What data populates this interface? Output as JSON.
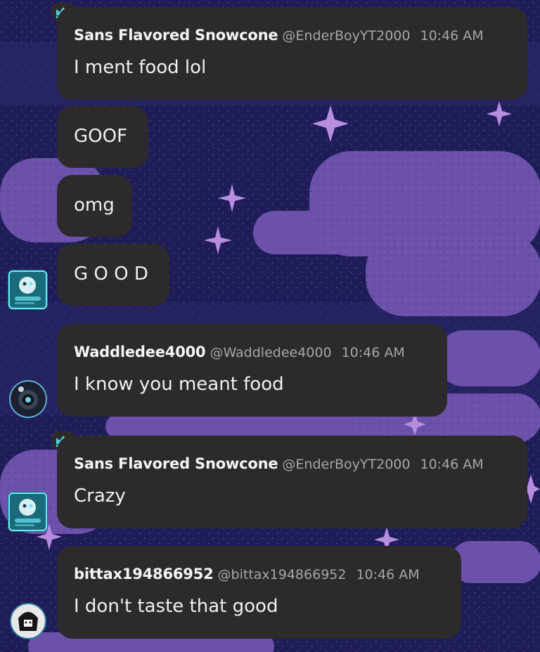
{
  "messages": [
    {
      "name": "Sans Flavored Snowcone",
      "handle": "@EnderBoyYT2000",
      "time": "10:46 AM",
      "text": "I ment food lol"
    },
    {
      "text": "GOOF"
    },
    {
      "text": "omg"
    },
    {
      "text": "G O O D"
    },
    {
      "name": "Waddledee4000",
      "handle": "@Waddledee4000",
      "time": "10:46 AM",
      "text": "I know you meant food"
    },
    {
      "name": "Sans Flavored Snowcone",
      "handle": "@EnderBoyYT2000",
      "time": "10:46 AM",
      "text": "Crazy"
    },
    {
      "name": "bittax194866952",
      "handle": "@bittax194866952",
      "time": "10:46 AM",
      "text": "I don't taste that good"
    }
  ],
  "icons": {
    "crown": "crown-icon"
  },
  "colors": {
    "background": "#24215c",
    "cloud": "#6a4fa8",
    "bubble": "#2c2a2b",
    "crown": "#4fd0e6",
    "meta": "#a7a7a7"
  }
}
